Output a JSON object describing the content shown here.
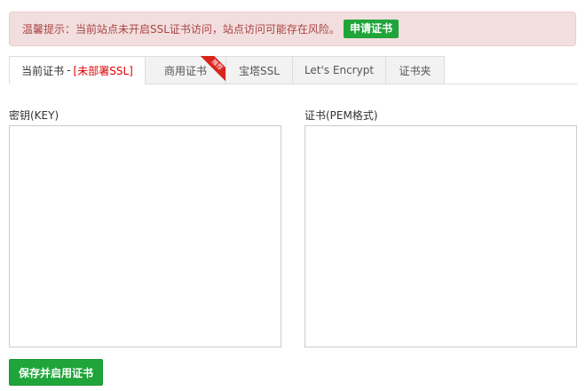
{
  "alert": {
    "text": "温馨提示：当前站点未开启SSL证书访问，站点访问可能存在风险。",
    "button_label": "申请证书"
  },
  "tabs": [
    {
      "label": "当前证书",
      "separator": "-",
      "status": "[未部署SSL]"
    },
    {
      "label": "商用证书",
      "ribbon": "推荐"
    },
    {
      "label": "宝塔SSL"
    },
    {
      "label": "Let's Encrypt"
    },
    {
      "label": "证书夹"
    }
  ],
  "key_field": {
    "label": "密钥(KEY)",
    "value": ""
  },
  "cert_field": {
    "label": "证书(PEM格式)",
    "value": ""
  },
  "save_button": {
    "label": "保存并启用证书"
  },
  "colors": {
    "accent_green": "#20a53a",
    "alert_bg": "#f2dede",
    "alert_text": "#a94442",
    "status_red": "#e00000",
    "ribbon_red": "#d9241b"
  }
}
